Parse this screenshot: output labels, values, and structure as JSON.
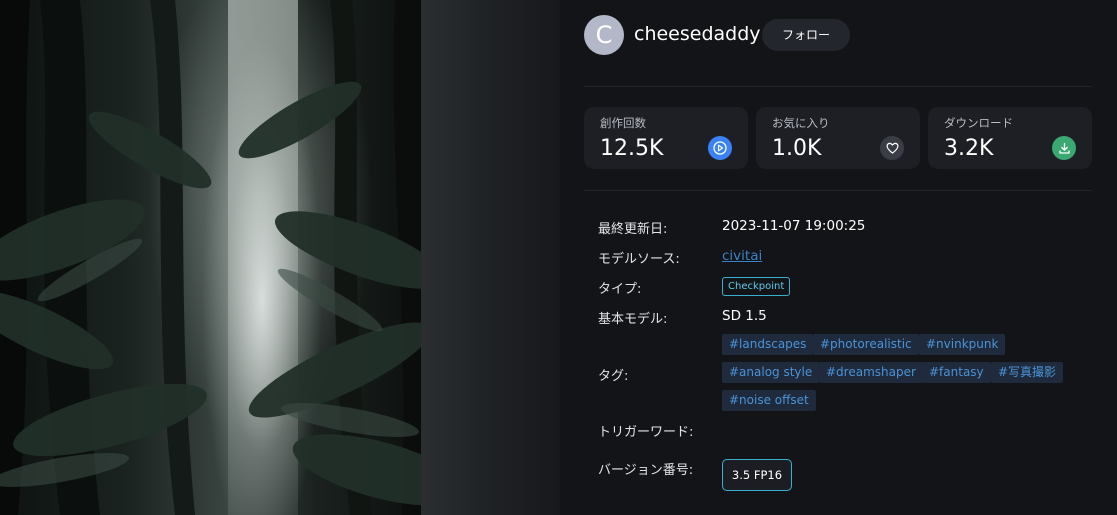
{
  "author": {
    "avatar_initial": "C",
    "username": "cheesedaddy",
    "follow_label": "フォロー"
  },
  "stats": [
    {
      "label": "創作回数",
      "value": "12.5K",
      "icon": "play-icon",
      "color": "#3b82f6"
    },
    {
      "label": "お気に入り",
      "value": "1.0K",
      "icon": "heart-icon",
      "color": "#3a3d45"
    },
    {
      "label": "ダウンロード",
      "value": "3.2K",
      "icon": "download-icon",
      "color": "#3aa872"
    }
  ],
  "details": {
    "updated_label": "最終更新日:",
    "updated_value": "2023-11-07 19:00:25",
    "source_label": "モデルソース:",
    "source_value": "civitai",
    "type_label": "タイプ:",
    "type_value": "Checkpoint",
    "base_label": "基本モデル:",
    "base_value": "SD 1.5",
    "tags_label": "タグ:",
    "tags": [
      "#landscapes",
      "#photorealistic",
      "#nvinkpunk",
      "#analog style",
      "#dreamshaper",
      "#fantasy",
      "#写真撮影",
      "#noise offset"
    ],
    "trigger_label": "トリガーワード:",
    "version_label": "バージョン番号:",
    "version_value": "3.5 FP16"
  },
  "colors": {
    "accent_link": "#3b82c4",
    "badge_border": "#3ab0d0",
    "panel_bg": "#131417",
    "card_bg": "#1d1f25"
  }
}
